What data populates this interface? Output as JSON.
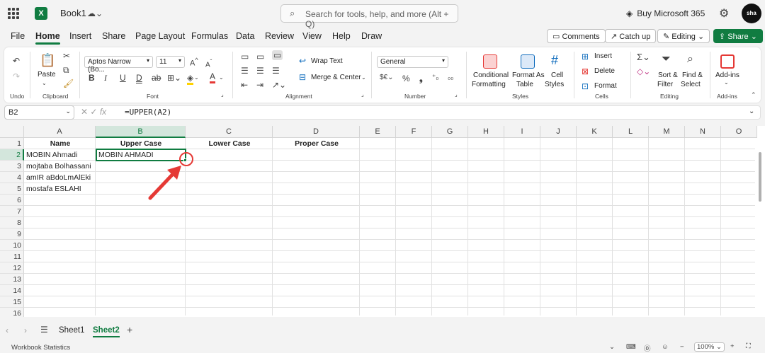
{
  "titlebar": {
    "book_name": "Book1",
    "search_placeholder": "Search for tools, help, and more (Alt + Q)",
    "buy_label": "Buy Microsoft 365",
    "avatar_text": "sha"
  },
  "tabs": [
    "File",
    "Home",
    "Insert",
    "Share",
    "Page Layout",
    "Formulas",
    "Data",
    "Review",
    "View",
    "Help",
    "Draw"
  ],
  "actions": {
    "comments": "Comments",
    "catch_up": "Catch up",
    "editing": "Editing",
    "share": "Share"
  },
  "ribbon": {
    "undo_label": "Undo",
    "paste_label": "Paste",
    "clipboard_label": "Clipboard",
    "font_name": "Aptos Narrow (Bo...",
    "font_size": "11",
    "font_label": "Font",
    "wrap_text": "Wrap Text",
    "merge_center": "Merge & Center",
    "alignment_label": "Alignment",
    "number_format": "General",
    "number_label": "Number",
    "conditional_formatting_1": "Conditional",
    "conditional_formatting_2": "Formatting",
    "format_as_table_1": "Format As",
    "format_as_table_2": "Table",
    "cell_styles_1": "Cell",
    "cell_styles_2": "Styles",
    "styles_label": "Styles",
    "insert": "Insert",
    "delete": "Delete",
    "format": "Format",
    "cells_label": "Cells",
    "sort_filter_1": "Sort &",
    "sort_filter_2": "Filter",
    "find_select_1": "Find &",
    "find_select_2": "Select",
    "editing_label": "Editing",
    "addins_1": "Add-ins",
    "addins_label": "Add-ins"
  },
  "formula_bar": {
    "name_box": "B2",
    "formula": "=UPPER(A2)"
  },
  "sheet": {
    "columns": [
      "A",
      "B",
      "C",
      "D",
      "E",
      "F",
      "G",
      "H",
      "I",
      "J",
      "K",
      "L",
      "M",
      "N",
      "O"
    ],
    "rows": [
      "1",
      "2",
      "3",
      "4",
      "5",
      "6",
      "7",
      "8",
      "9",
      "10",
      "11",
      "12",
      "13",
      "14",
      "15",
      "16"
    ],
    "headers": {
      "A1": "Name",
      "B1": "Upper Case",
      "C1": "Lower Case",
      "D1": "Proper Case"
    },
    "names": [
      "MOBIN Ahmadi",
      "mojtaba Bolhassani",
      "amIR aBdoLmAlEki",
      "mostafa ESLAHI"
    ],
    "B2": "MOBIN AHMADI",
    "active_cell": "B2"
  },
  "sheet_tabs": [
    "Sheet1",
    "Sheet2"
  ],
  "active_sheet": "Sheet2",
  "status": {
    "left": "Workbook Statistics",
    "zoom": "100%"
  },
  "colors": {
    "accent": "#107c41",
    "annotation": "#e53935"
  }
}
